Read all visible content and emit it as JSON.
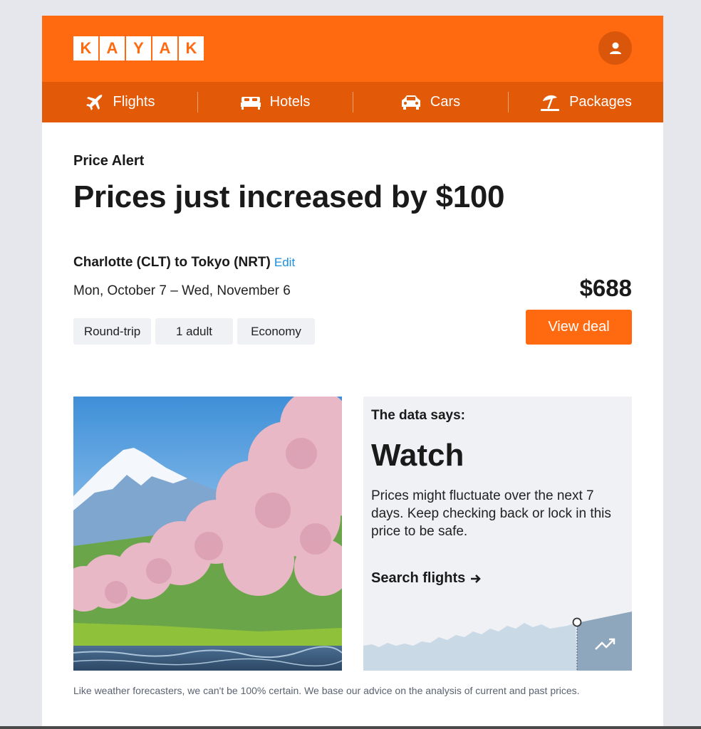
{
  "brand": {
    "letters": [
      "K",
      "A",
      "Y",
      "A",
      "K"
    ],
    "color": "#ff690f"
  },
  "header": {
    "avatar_icon": "user-icon"
  },
  "nav": {
    "items": [
      {
        "label": "Flights",
        "icon": "plane-icon"
      },
      {
        "label": "Hotels",
        "icon": "bed-icon"
      },
      {
        "label": "Cars",
        "icon": "car-icon"
      },
      {
        "label": "Packages",
        "icon": "beach-umbrella-icon"
      }
    ]
  },
  "alert": {
    "label": "Price Alert",
    "headline": "Prices just increased by $100"
  },
  "trip": {
    "route": "Charlotte (CLT) to Tokyo (NRT)",
    "edit_label": "Edit",
    "dates": "Mon, October 7 – Wed, November 6",
    "chips": [
      "Round-trip",
      "1 adult",
      "Economy"
    ],
    "price": "$688",
    "cta_label": "View deal"
  },
  "advice": {
    "intro": "The data says:",
    "verdict": "Watch",
    "description": "Prices might fluctuate over the next 7 days. Keep checking back or lock in this price to be safe.",
    "link_label": "Search flights",
    "trend_icon": "trending-up-icon"
  },
  "footer": {
    "disclaimer": "Like weather forecasters, we can't be 100% certain. We base our advice on the analysis of current and past prices."
  }
}
